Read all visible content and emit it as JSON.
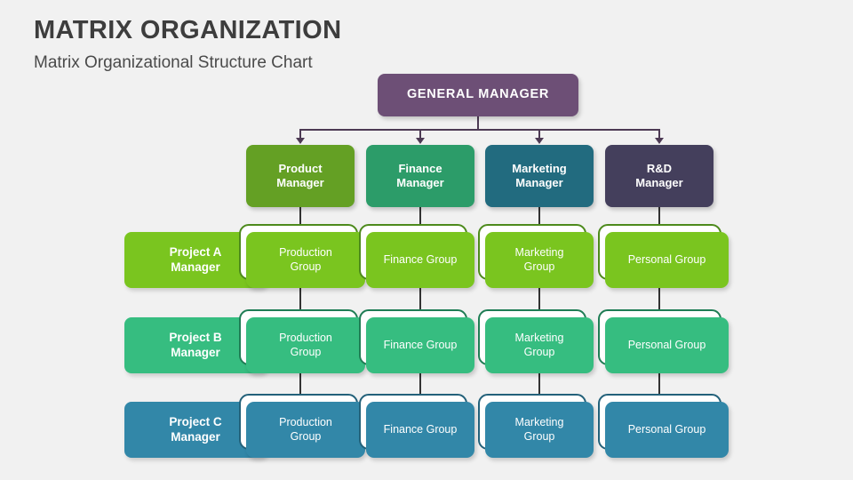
{
  "header": {
    "title": "MATRIX ORGANIZATION",
    "subtitle": "Matrix Organizational Structure Chart"
  },
  "colors": {
    "background": "#f1f1f1",
    "title_text": "#3d3d3d",
    "connector": "#4d3a54",
    "spine": "#333333",
    "general_manager": "#6d4f76",
    "product_manager": "#64a024",
    "finance_manager": "#2c9c69",
    "marketing_manager": "#226b7f",
    "rd_manager": "#443f5c",
    "project_a": "#7ac51f",
    "project_a_outline": "#4d8a1c",
    "project_b": "#36bd80",
    "project_b_outline": "#1f7d55",
    "project_c": "#3287a8",
    "project_c_outline": "#23617a"
  },
  "chart_data": {
    "type": "diagram",
    "diagram_kind": "matrix-organization-chart",
    "title": "MATRIX ORGANIZATION",
    "subtitle": "Matrix Organizational Structure Chart",
    "top": {
      "label": "GENERAL MANAGER"
    },
    "functional_managers": [
      {
        "label": "Product\nManager",
        "line1": "Product",
        "line2": "Manager"
      },
      {
        "label": "Finance\nManager",
        "line1": "Finance",
        "line2": "Manager"
      },
      {
        "label": "Marketing\nManager",
        "line1": "Marketing",
        "line2": "Manager"
      },
      {
        "label": "R&D\nManager",
        "line1": "R&D",
        "line2": "Manager"
      }
    ],
    "project_rows": [
      {
        "manager_line1": "Project A",
        "manager_line2": "Manager",
        "cells": [
          {
            "line1": "Production",
            "line2": "Group"
          },
          {
            "line1": "Finance Group",
            "line2": ""
          },
          {
            "line1": "Marketing",
            "line2": "Group"
          },
          {
            "line1": "Personal Group",
            "line2": ""
          }
        ]
      },
      {
        "manager_line1": "Project B",
        "manager_line2": "Manager",
        "cells": [
          {
            "line1": "Production",
            "line2": "Group"
          },
          {
            "line1": "Finance Group",
            "line2": ""
          },
          {
            "line1": "Marketing",
            "line2": "Group"
          },
          {
            "line1": "Personal Group",
            "line2": ""
          }
        ]
      },
      {
        "manager_line1": "Project C",
        "manager_line2": "Manager",
        "cells": [
          {
            "line1": "Production",
            "line2": "Group"
          },
          {
            "line1": "Finance Group",
            "line2": ""
          },
          {
            "line1": "Marketing",
            "line2": "Group"
          },
          {
            "line1": "Personal Group",
            "line2": ""
          }
        ]
      }
    ]
  },
  "top_node": {
    "label": "GENERAL MANAGER"
  },
  "managers": [
    {
      "line1": "Product",
      "line2": "Manager"
    },
    {
      "line1": "Finance",
      "line2": "Manager"
    },
    {
      "line1": "Marketing",
      "line2": "Manager"
    },
    {
      "line1": "R&D",
      "line2": "Manager"
    }
  ],
  "rows": [
    {
      "manager": {
        "line1": "Project A",
        "line2": "Manager"
      },
      "cells": [
        {
          "line1": "Production",
          "line2": "Group"
        },
        {
          "line1": "Finance Group",
          "line2": ""
        },
        {
          "line1": "Marketing",
          "line2": "Group"
        },
        {
          "line1": "Personal Group",
          "line2": ""
        }
      ]
    },
    {
      "manager": {
        "line1": "Project B",
        "line2": "Manager"
      },
      "cells": [
        {
          "line1": "Production",
          "line2": "Group"
        },
        {
          "line1": "Finance Group",
          "line2": ""
        },
        {
          "line1": "Marketing",
          "line2": "Group"
        },
        {
          "line1": "Personal Group",
          "line2": ""
        }
      ]
    },
    {
      "manager": {
        "line1": "Project C",
        "line2": "Manager"
      },
      "cells": [
        {
          "line1": "Production",
          "line2": "Group"
        },
        {
          "line1": "Finance Group",
          "line2": ""
        },
        {
          "line1": "Marketing",
          "line2": "Group"
        },
        {
          "line1": "Personal Group",
          "line2": ""
        }
      ]
    }
  ]
}
